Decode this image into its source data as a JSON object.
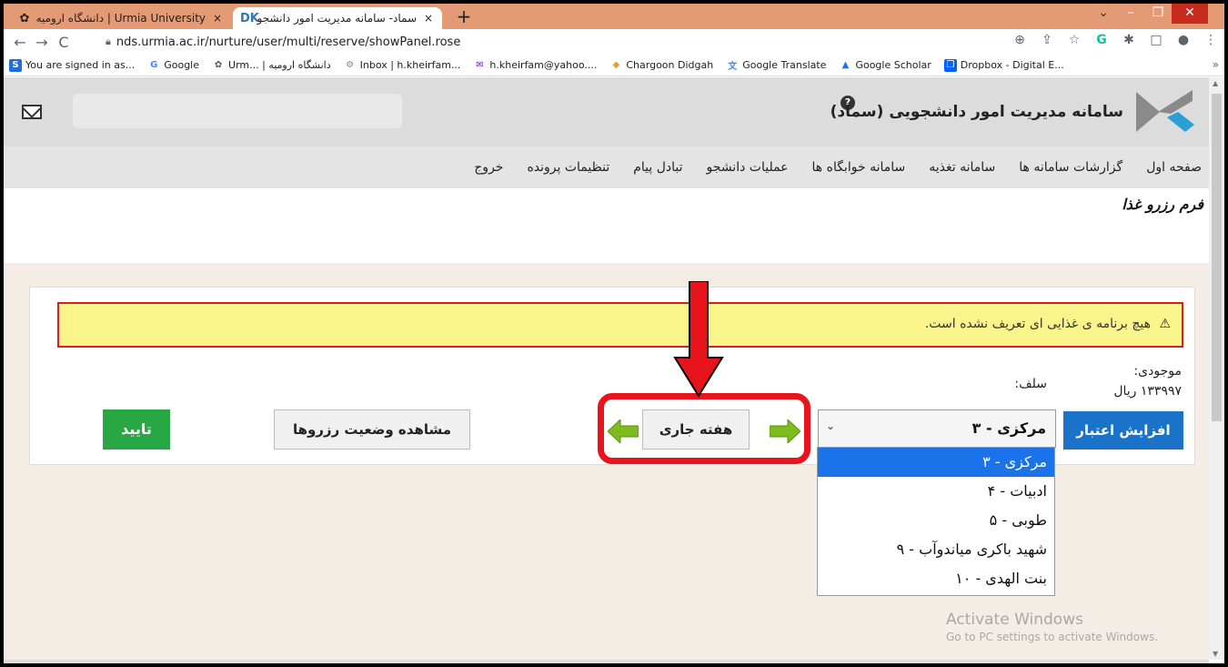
{
  "browser": {
    "tabs": [
      {
        "title": "Urmia University | دانشگاه ارومیه",
        "favicon": "university-crest-icon",
        "close": "×"
      },
      {
        "title": "سماد- سامانه مدیریت امور دانشجو",
        "favicon": "samad-logo-icon",
        "close": "×"
      }
    ],
    "new_tab": "+",
    "window_controls": {
      "chevron": "⌄",
      "minimize": "–",
      "maximize": "❐",
      "close": "✕"
    },
    "nav": {
      "back": "←",
      "forward": "→",
      "reload": "C"
    },
    "url": "nds.urmia.ac.ir/nurture/user/multi/reserve/showPanel.rose",
    "bookmarks": [
      {
        "label": "You are signed in as...",
        "icon": "S",
        "color": "#1e6fd9"
      },
      {
        "label": "Google",
        "icon": "G",
        "color": "#4285f4"
      },
      {
        "label": "Urm... | دانشگاه ارومیه",
        "icon": "✿",
        "color": "#555555"
      },
      {
        "label": "Inbox | h.kheirfam...",
        "icon": "⚙",
        "color": "#888888"
      },
      {
        "label": "h.kheirfam@yahoo....",
        "icon": "✉",
        "color": "#6a1bb5"
      },
      {
        "label": "Chargoon Didgah",
        "icon": "◆",
        "color": "#e2a21b"
      },
      {
        "label": "Google Translate",
        "icon": "文",
        "color": "#4285f4"
      },
      {
        "label": "Google Scholar",
        "icon": "▲",
        "color": "#1a73e8"
      },
      {
        "label": "Dropbox - Digital E...",
        "icon": "❒",
        "color": "#0061fe"
      }
    ],
    "bookmarks_more": "»"
  },
  "header": {
    "site_title": "سامانه مدیریت امور دانشجویی (سماد)",
    "help_icon": "?"
  },
  "menu": [
    "صفحه اول",
    "گزارشات سامانه ها",
    "سامانه تغذیه",
    "سامانه خوابگاه ها",
    "عملیات دانشجو",
    "تبادل پیام",
    "تنظیمات پرونده",
    "خروج"
  ],
  "form": {
    "title": "فرم رزرو غذا",
    "warning": "هیچ برنامه ی غذایی ای تعریف نشده است.",
    "balance_label": "موجودی:",
    "balance_value": "۱۳۳۹۹۷ ریال",
    "advance_label": "سلف:",
    "increase_credit": "افزایش اعتبار",
    "self_selected": "مرکزی - ۳",
    "self_options": [
      "مرکزی - ۳",
      "ادبیات - ۴",
      "طوبی - ۵",
      "شهید باکری میاندوآب - ۹",
      "بنت الهدی - ۱۰"
    ],
    "current_week": "هفته جاری",
    "view_status": "مشاهده وضعیت رزروها",
    "confirm": "تایید"
  },
  "watermark": {
    "title": "Activate Windows",
    "subtitle": "Go to PC settings to activate Windows."
  },
  "colors": {
    "tab_strip": "#e49a75",
    "primary_blue": "#1a73c8",
    "confirm_green": "#28a745",
    "warning_bg": "#fbf48a",
    "highlight_red": "#e8141c",
    "arrow_green": "#7dbb1f"
  }
}
